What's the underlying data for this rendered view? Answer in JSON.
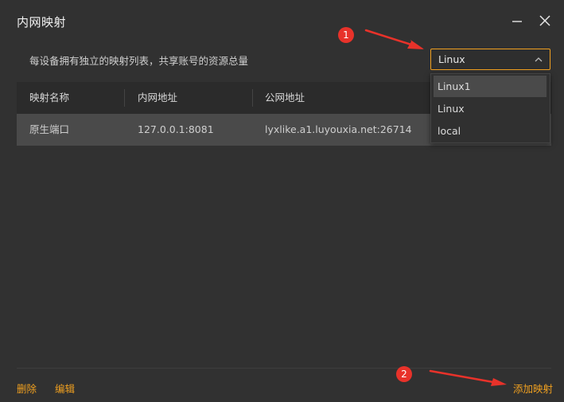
{
  "window": {
    "title": "内网映射"
  },
  "description": "每设备拥有独立的映射列表，共享账号的资源总量",
  "device_select": {
    "value": "Linux",
    "options": [
      "Linux1",
      "Linux",
      "local"
    ],
    "highlighted_option": "Linux1"
  },
  "table": {
    "headers": [
      "映射名称",
      "内网地址",
      "公网地址"
    ],
    "rows": [
      {
        "name": "原生端口",
        "local_addr": "127.0.0.1:8081",
        "public_addr": "lyxlike.a1.luyouxia.net:26714"
      }
    ]
  },
  "footer": {
    "delete_label": "删除",
    "edit_label": "编辑",
    "add_label": "添加映射"
  },
  "annotations": {
    "badge1": "1",
    "badge2": "2"
  },
  "colors": {
    "accent": "#f0a020",
    "background": "#313131",
    "annotation_red": "#e8322a"
  }
}
